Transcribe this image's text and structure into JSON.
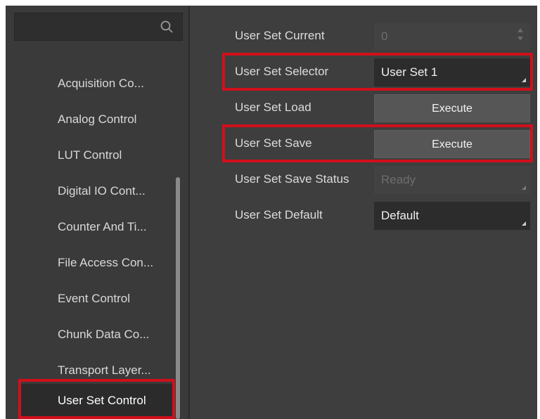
{
  "sidebar": {
    "search": {
      "placeholder": ""
    },
    "items": [
      {
        "label": "Acquisition Co..."
      },
      {
        "label": "Analog Control"
      },
      {
        "label": "LUT Control"
      },
      {
        "label": "Digital IO Cont..."
      },
      {
        "label": "Counter And Ti..."
      },
      {
        "label": "File Access Con..."
      },
      {
        "label": "Event Control"
      },
      {
        "label": "Chunk Data Co..."
      },
      {
        "label": "Transport Layer..."
      },
      {
        "label": "User Set Control"
      }
    ]
  },
  "params": {
    "user_set_current": {
      "label": "User Set Current",
      "value": "0"
    },
    "user_set_selector": {
      "label": "User Set Selector",
      "value": "User Set 1"
    },
    "user_set_load": {
      "label": "User Set Load",
      "button": "Execute"
    },
    "user_set_save": {
      "label": "User Set Save",
      "button": "Execute"
    },
    "user_set_save_status": {
      "label": "User Set Save Status",
      "value": "Ready"
    },
    "user_set_default": {
      "label": "User Set Default",
      "value": "Default"
    }
  },
  "colors": {
    "highlight": "#d0101b",
    "panel_bg": "#3e3e3e",
    "field_dark": "#2c2c2c",
    "button_bg": "#565656"
  }
}
